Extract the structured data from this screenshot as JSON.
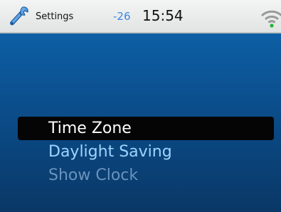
{
  "status_bar": {
    "app_icon": "wrench-icon",
    "title": "Settings",
    "signal_strength": "-26",
    "time": "15:54",
    "connection_icon": "wifi-icon"
  },
  "menu": {
    "items": [
      {
        "label": "Time Zone",
        "state": "selected"
      },
      {
        "label": "Daylight Saving",
        "state": "normal"
      },
      {
        "label": "Show Clock",
        "state": "disabled"
      }
    ]
  },
  "colors": {
    "screen_top": "#0d5fa5",
    "screen_bottom": "#093866",
    "selection": "#050505",
    "signal_text": "#3a88e0"
  }
}
